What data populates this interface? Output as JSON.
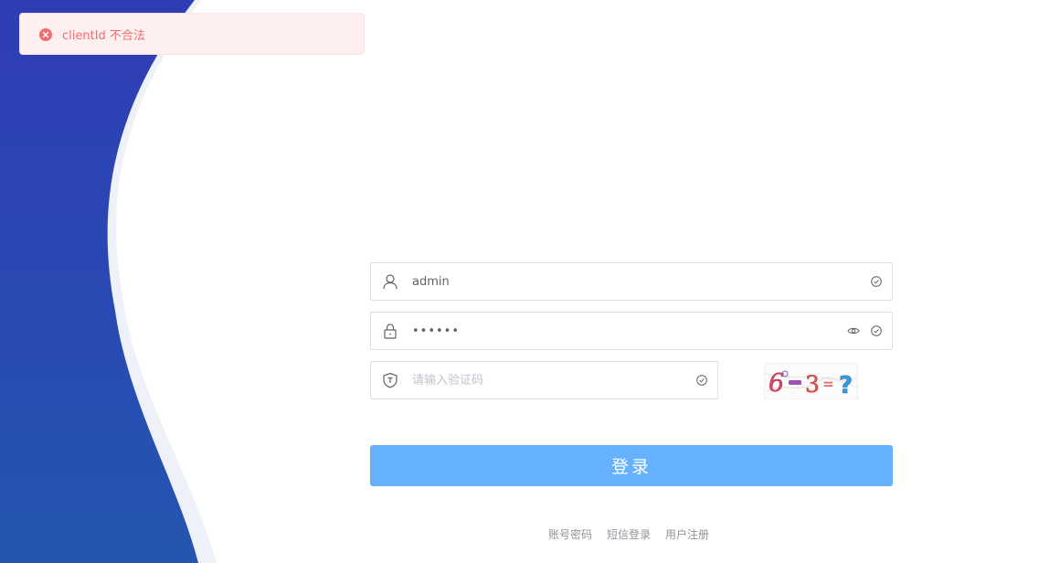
{
  "notification": {
    "type": "error",
    "icon": "circle-close-icon",
    "message": "clientId 不合法",
    "color": "#f56c6c"
  },
  "login_form": {
    "username": {
      "icon": "user-icon",
      "value": "admin",
      "suffix_icon": "circle-check-icon"
    },
    "password": {
      "icon": "lock-icon",
      "masked_value": "••••••",
      "suffix_icons": [
        "eye-icon",
        "circle-check-icon"
      ]
    },
    "captcha": {
      "icon": "shield-text-icon",
      "placeholder": "请输入验证码",
      "value": "",
      "suffix_icon": "circle-check-icon",
      "image_text": "6−3=?"
    },
    "submit_label": "登录",
    "submit_color": "#66b1ff"
  },
  "links": {
    "account_password": "账号密码",
    "sms_login": "短信登录",
    "register": "用户注册"
  },
  "theme": {
    "primary_wave": "#2b3fb5",
    "secondary_wave": "#eef2f8"
  }
}
